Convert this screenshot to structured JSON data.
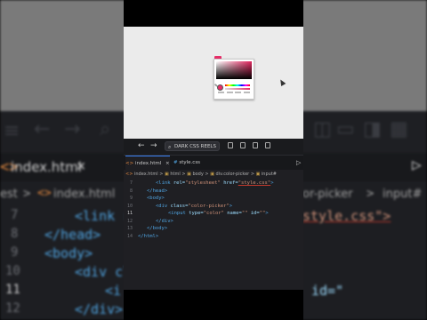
{
  "editor": {
    "search_label": "DARK CSS REELS",
    "tabs": [
      {
        "label": "index.html",
        "active": true
      },
      {
        "label": "style.css",
        "active": false
      }
    ],
    "breadcrumb": {
      "file": "index.html",
      "items": [
        "html",
        "body",
        "div.color-picker",
        "input#"
      ]
    },
    "code_lines": [
      {
        "num": "7",
        "current": false
      },
      {
        "num": "8",
        "current": false
      },
      {
        "num": "9",
        "current": false
      },
      {
        "num": "10",
        "current": false
      },
      {
        "num": "11",
        "current": true
      },
      {
        "num": "12",
        "current": false
      },
      {
        "num": "13",
        "current": false
      },
      {
        "num": "14",
        "current": false
      }
    ],
    "tokens": {
      "link_tag": "<link",
      "rel_attr": "rel=",
      "rel_val": "\"stylesheet\"",
      "href_attr": "href=",
      "href_val": "\"style.css\"",
      "close_gt": ">",
      "head_close": "</head>",
      "body_open": "<body>",
      "div_open": "<div",
      "class_attr": "class=",
      "class_val": "\"color-picker\"",
      "input_tag": "<input",
      "type_attr": "type=",
      "type_val": "\"color\"",
      "name_attr": "name=",
      "name_val": "\"\"",
      "id_attr": "id=",
      "id_val": "\"\"",
      "div_close": "</div>",
      "body_close": "</body>",
      "html_close": "</html>"
    }
  },
  "background": {
    "tab_label": "index.html",
    "crumb_file": "index.html",
    "crumb_tail": "or-picker",
    "crumb_tail2": "input#",
    "crumb_head": "est",
    "line_numbers": [
      "7",
      "8",
      "9",
      "10",
      "11",
      "12",
      "13"
    ],
    "code_fragments": {
      "l7": "<link r",
      "l7_right": "style.css\">",
      "l8": "</head>",
      "l9": "<body>",
      "l10": "<div cl",
      "l11": "<i",
      "l11_right": "id=\"",
      "l12": "</div>",
      "l13": "</b"
    }
  },
  "colors": {
    "picked_color": "#e62e68",
    "accent": "#3b82f6"
  }
}
